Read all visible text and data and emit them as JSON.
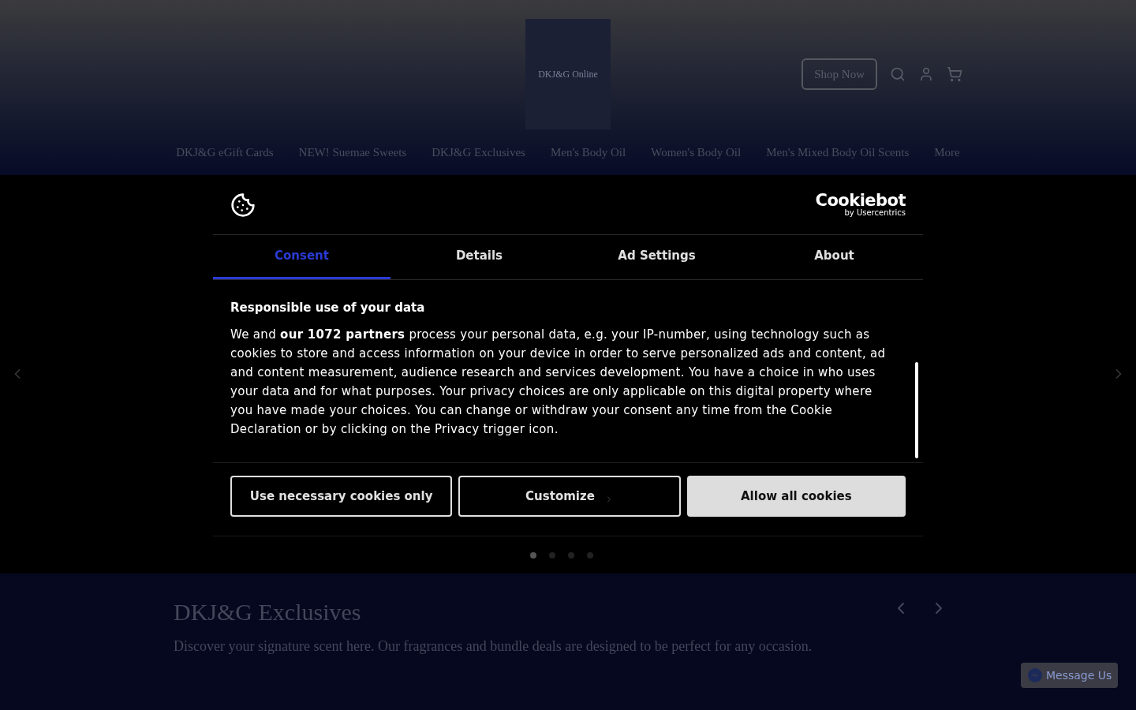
{
  "header": {
    "logo_text": "DKJ&G Online",
    "shop_button": "Shop Now"
  },
  "nav": [
    "DKJ&G eGift Cards",
    "NEW! Suemae Sweets",
    "DKJ&G Exclusives",
    "Men's Body Oil",
    "Women's Body Oil",
    "Men's Mixed Body Oil Scents",
    "More"
  ],
  "cookie_dialog": {
    "brand": "Cookiebot",
    "brand_sub": "by Usercentrics",
    "tabs": [
      {
        "label": "Consent",
        "selected": true
      },
      {
        "label": "Details",
        "selected": false
      },
      {
        "label": "Ad Settings",
        "selected": false
      },
      {
        "label": "About",
        "selected": false
      }
    ],
    "heading": "Responsible use of your data",
    "body": "We and **our 1072 partners** process your personal data, e.g. your IP-number, using technology such as cookies to store and access information on your device in order to serve personalized ads and content, ad and content measurement, audience research and services development. You have a choice in who uses your data and for what purposes. Your privacy choices are only applicable on this digital property where you have made your choices. You can change or withdraw your consent any time from the Cookie Declaration or by clicking on the Privacy trigger icon.",
    "buttons": [
      {
        "label": "Use necessary cookies only",
        "kind": "outline"
      },
      {
        "label": "Customize",
        "kind": "customize"
      },
      {
        "label": "Allow all cookies",
        "kind": "filled"
      }
    ]
  },
  "carousel_dots": [
    {
      "selected": true
    },
    {
      "selected": false
    },
    {
      "selected": false
    },
    {
      "selected": false
    }
  ],
  "section": {
    "title": "DKJ&G Exclusives",
    "text": "Discover your signature scent here. Our fragrances and bundle deals are designed to be perfect for any occasion."
  },
  "chat_button": "Message Us"
}
